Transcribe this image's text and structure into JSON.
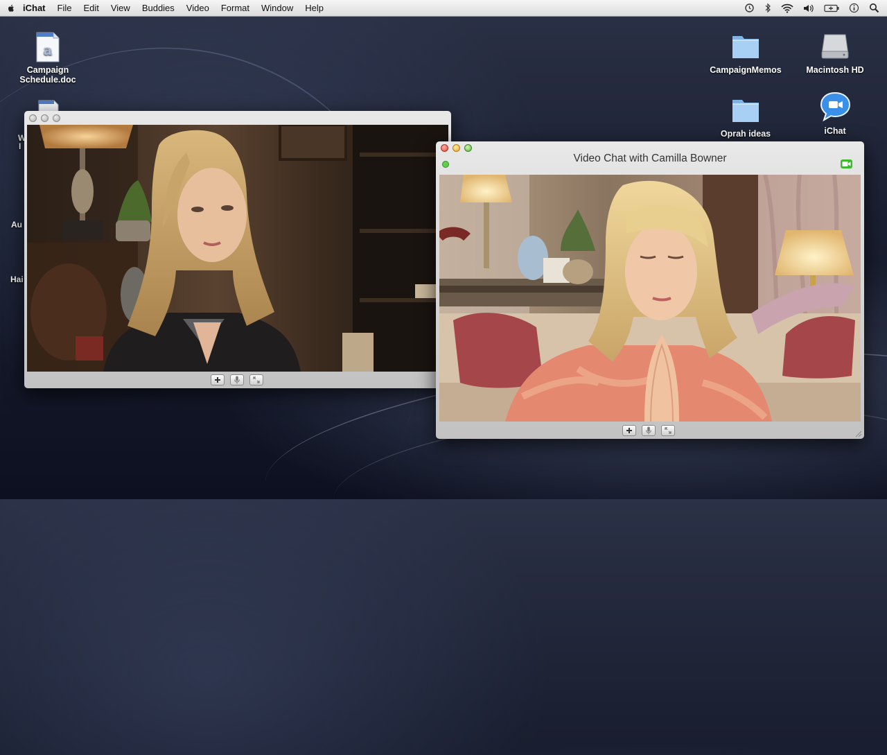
{
  "menubar": {
    "app": "iChat",
    "items": [
      "File",
      "Edit",
      "View",
      "Buddies",
      "Video",
      "Format",
      "Window",
      "Help"
    ],
    "status_icons": [
      "time-machine-icon",
      "bluetooth-icon",
      "wifi-icon",
      "volume-icon",
      "battery-icon",
      "info-icon",
      "spotlight-icon"
    ]
  },
  "desktop": {
    "icons": [
      {
        "label_line1": "Campaign",
        "label_line2": "Schedule.doc"
      },
      {
        "label": "CampaignMemos"
      },
      {
        "label": "Macintosh HD"
      },
      {
        "label": "Oprah ideas"
      },
      {
        "label": "iChat"
      }
    ],
    "cut_labels": [
      "W",
      "I",
      "Au",
      "Hai"
    ]
  },
  "left_window": {
    "title": ""
  },
  "right_window": {
    "title": "Video Chat with Camilla Bowner"
  },
  "colors": {
    "accent_green": "#3dbb2f",
    "close_red": "#e0443a",
    "minimize_yellow": "#e7a92e",
    "zoom_green": "#58b33a"
  }
}
